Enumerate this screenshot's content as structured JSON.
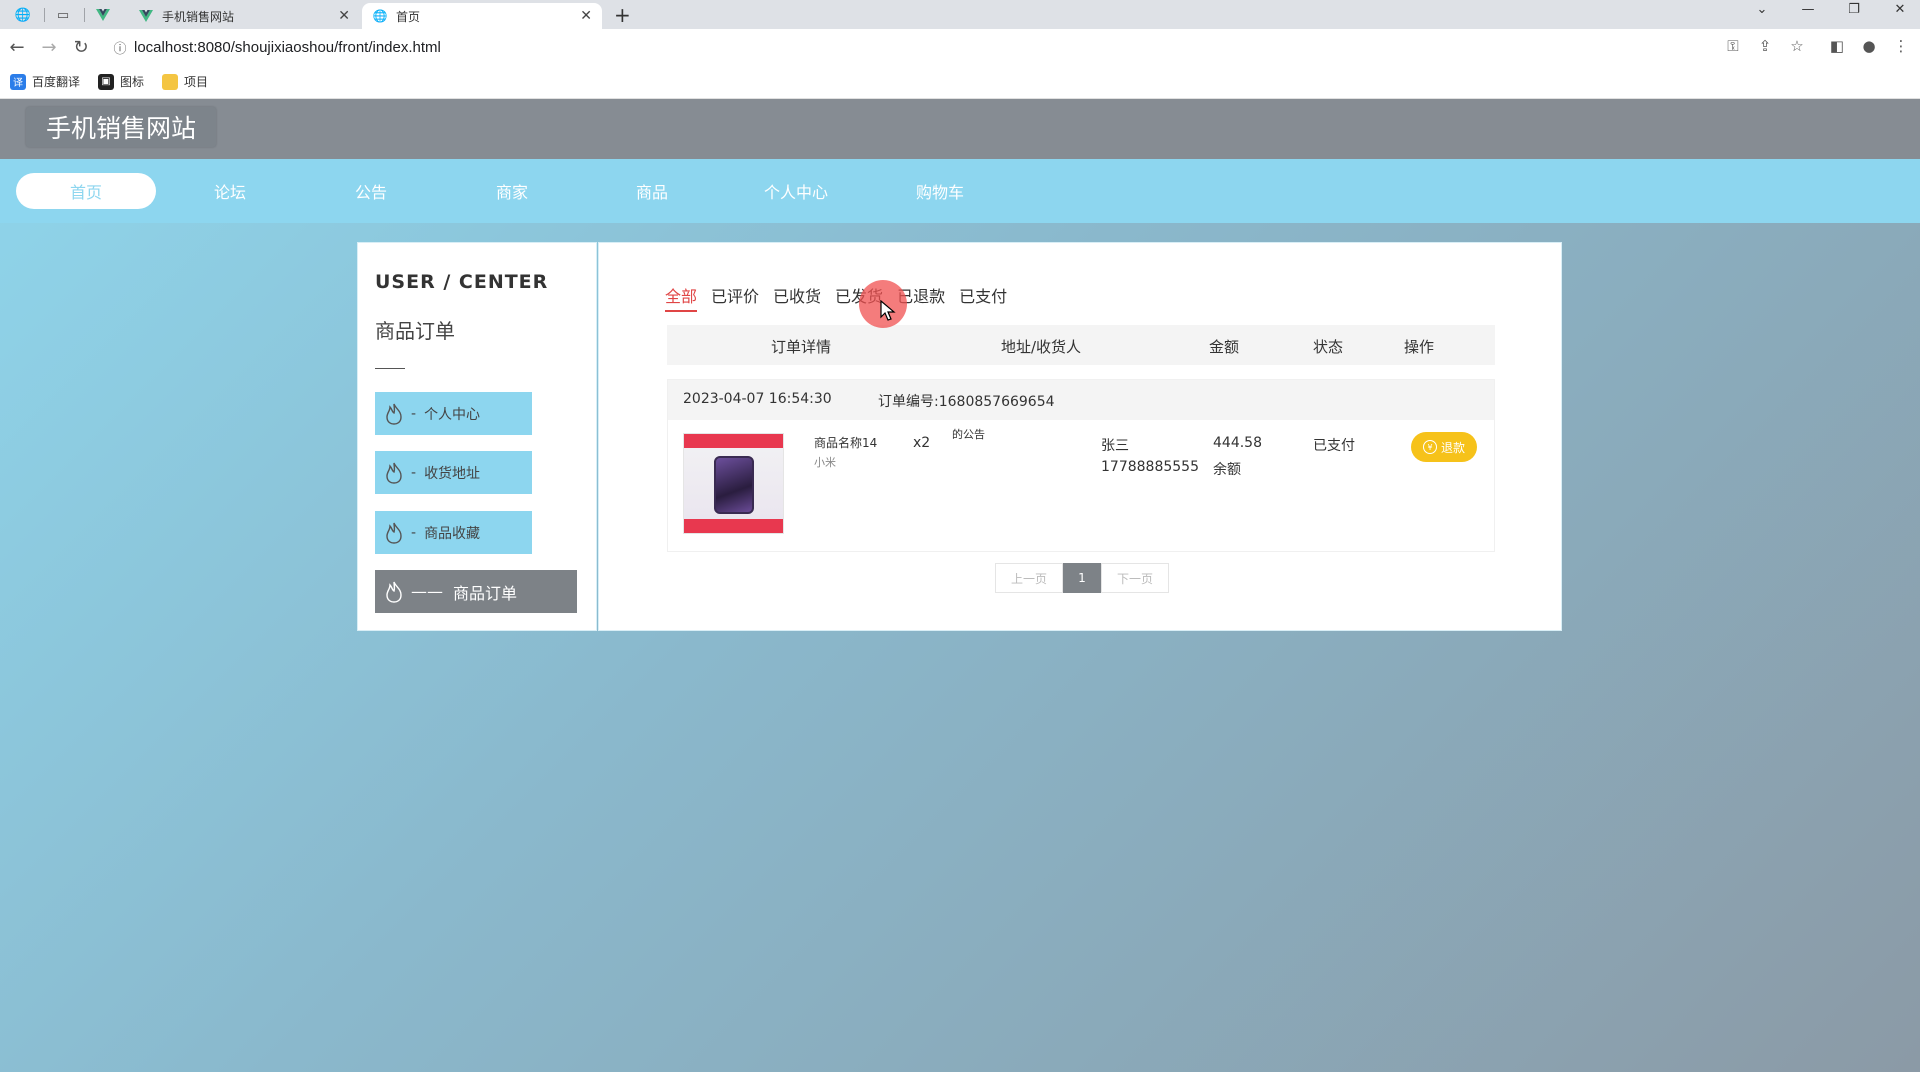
{
  "browser": {
    "tabs": [
      {
        "label": "手机销售网站",
        "active": false
      },
      {
        "label": "首页",
        "active": true
      }
    ],
    "url": "localhost:8080/shoujixiaoshou/front/index.html",
    "bookmarks": [
      {
        "label": "百度翻译",
        "icon": "translate-icon",
        "color": "#2b7de9"
      },
      {
        "label": "图标",
        "icon": "image-icon",
        "color": "#222222"
      },
      {
        "label": "项目",
        "icon": "folder-icon",
        "color": "#f4c542"
      }
    ]
  },
  "site": {
    "title": "手机销售网站",
    "nav": [
      "首页",
      "论坛",
      "公告",
      "商家",
      "商品",
      "个人中心",
      "购物车"
    ],
    "active_nav": "首页"
  },
  "sidebar": {
    "heading": "USER / CENTER",
    "subheading": "商品订单",
    "items": [
      {
        "label": "个人中心",
        "prefix": "-"
      },
      {
        "label": "收货地址",
        "prefix": "-"
      },
      {
        "label": "商品收藏",
        "prefix": "-"
      },
      {
        "label": "商品订单",
        "prefix": "——",
        "active": true
      }
    ]
  },
  "orders": {
    "filter_tabs": [
      "全部",
      "已评价",
      "已收货",
      "已发货",
      "已退款",
      "已支付"
    ],
    "active_tab": "全部",
    "columns": [
      "订单详情",
      "地址/收货人",
      "金额",
      "状态",
      "操作"
    ],
    "items": [
      {
        "time": "2023-04-07 16:54:30",
        "order_no": "订单编号:1680857669654",
        "product_name": "商品名称14",
        "brand": "小米",
        "quantity": "x2",
        "address": "的公告",
        "receiver": "张三",
        "phone": "17788885555",
        "amount": "444.58",
        "pay_method": "余额",
        "status": "已支付",
        "action": "退款"
      }
    ]
  },
  "pagination": {
    "prev": "上一页",
    "current": "1",
    "next": "下一页"
  },
  "colors": {
    "nav_bg": "#8dd6ef",
    "header_bg": "#868c93",
    "active_tab": "#e04545",
    "refund": "#f6c21a"
  }
}
